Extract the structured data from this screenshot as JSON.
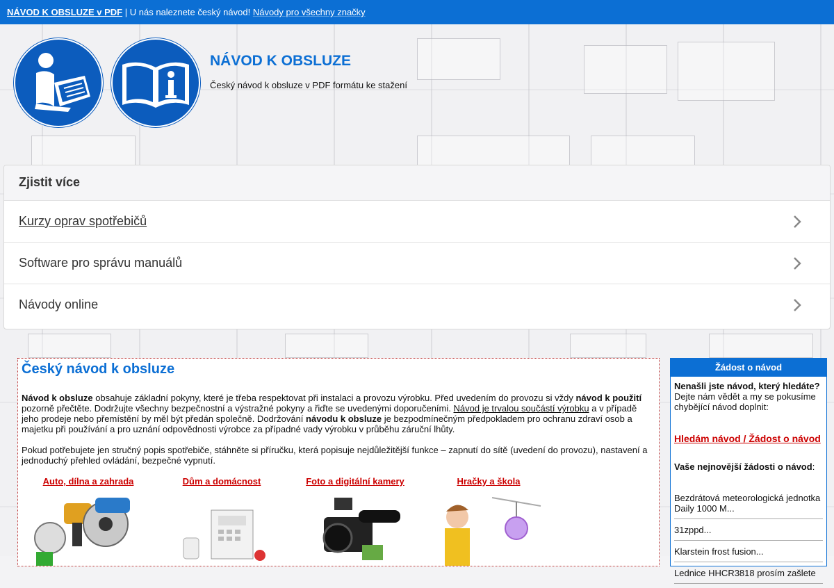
{
  "topbar": {
    "brand": "NÁVOD K OBSLUZE v PDF",
    "separator": "|",
    "tagline": "U nás naleznete český návod!",
    "link": "Návody pro všechny značky"
  },
  "header": {
    "title": "NÁVOD K OBSLUZE",
    "subtitle": "Český návod k obsluze v PDF formátu ke stažení",
    "logos": [
      "reading-manual-icon",
      "info-book-icon"
    ]
  },
  "more": {
    "heading": "Zjistit více",
    "items": [
      {
        "label": "Kurzy oprav spotřebičů"
      },
      {
        "label": "Software pro správu manuálů"
      },
      {
        "label": "Návody online"
      }
    ]
  },
  "main": {
    "title": "Český návod k obsluze",
    "p1": {
      "b1": "Návod k obsluze",
      "t1": " obsahuje základní pokyny, které je třeba respektovat při instalaci a provozu výrobku. Před uvedením do provozu si vždy ",
      "b2": "návod k použití",
      "t2": " pozorně přečtěte. Dodržujte všechny bezpečnostní a výstražné pokyny a řiďte se uvedenými doporučeními. ",
      "link": "Návod je trvalou součástí výrobku",
      "t3": " a v případě jeho prodeje nebo přemístění by měl být předán společně. Dodržování ",
      "b3": "návodu k obsluze",
      "t4": " je bezpodmínečným předpokladem pro ochranu zdraví osob a majetku při používání a pro uznání odpovědnosti výrobce za případné vady výrobku v průběhu záruční lhůty."
    },
    "p2": "Pokud potřebujete jen stručný popis spotřebiče, stáhněte si příručku, která popisuje nejdůležitější funkce – zapnutí do sítě (uvedení do provozu), nastavení a jednoduchý přehled ovládání, bezpečné vypnutí.",
    "categories": [
      {
        "label": "Auto, dílna a zahrada"
      },
      {
        "label": "Dům a domácnost"
      },
      {
        "label": "Foto a digitální kamery"
      },
      {
        "label": "Hračky a škola"
      }
    ]
  },
  "side": {
    "heading": "Žádost o návod",
    "intro_bold": "Nenašli jste návod, který hledáte?",
    "intro_text": " Dejte nám vědět a my se pokusíme chybějící návod doplnit:",
    "link": "Hledám návod / Žádost o návod",
    "latest_label": "Vaše nejnovější žádosti o návod",
    "latest_colon": ":",
    "requests": [
      "Bezdrátová meteorologická jednotka Daily 1000 M...",
      "31zppd...",
      "Klarstein frost fusion...",
      "Lednice HHCR3818 prosím zašlete"
    ]
  },
  "colors": {
    "primary": "#0c6fd4",
    "logo": "#0c5cbd",
    "link_red": "#cc0000"
  }
}
